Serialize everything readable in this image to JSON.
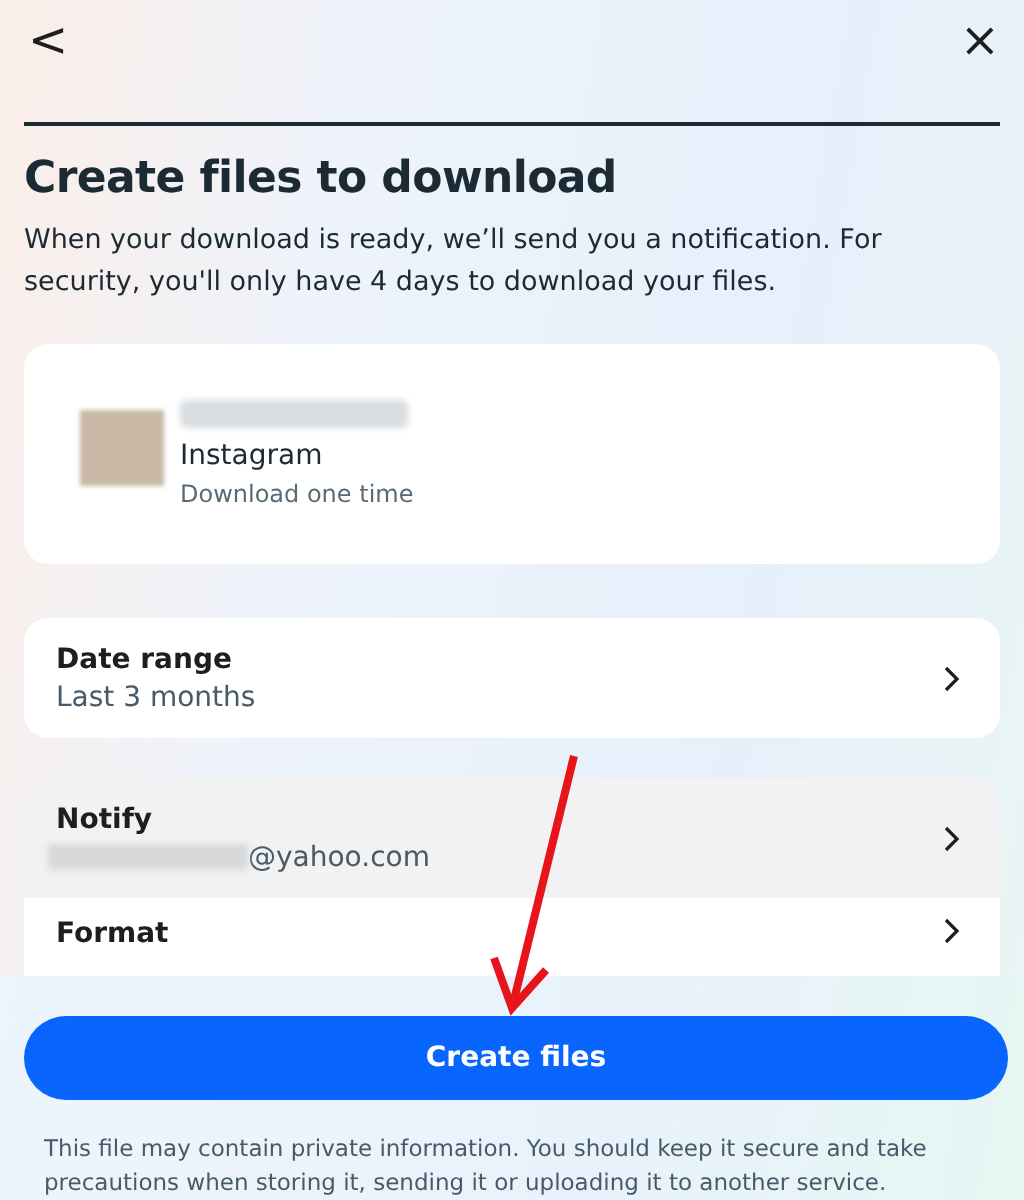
{
  "header": {
    "back": "<",
    "close": "×"
  },
  "title": "Create files to download",
  "description": "When your download is ready, we’ll send you a notification. For security, you'll only have 4 days to download your files.",
  "account": {
    "app": "Instagram",
    "frequency": "Download one time"
  },
  "settings": [
    {
      "label": "Date range",
      "value": "Last 3 months",
      "selected": false
    }
  ],
  "more_settings": [
    {
      "label": "Notify",
      "value": "@yahoo.com",
      "redacted_prefix": true,
      "selected": true
    },
    {
      "label": "Format",
      "redacted_prefix": false,
      "selected": false
    }
  ],
  "button": "Create files",
  "footer": "This file may contain private information. You should keep it secure and take precautions when storing it, sending it or uploading it to another service."
}
